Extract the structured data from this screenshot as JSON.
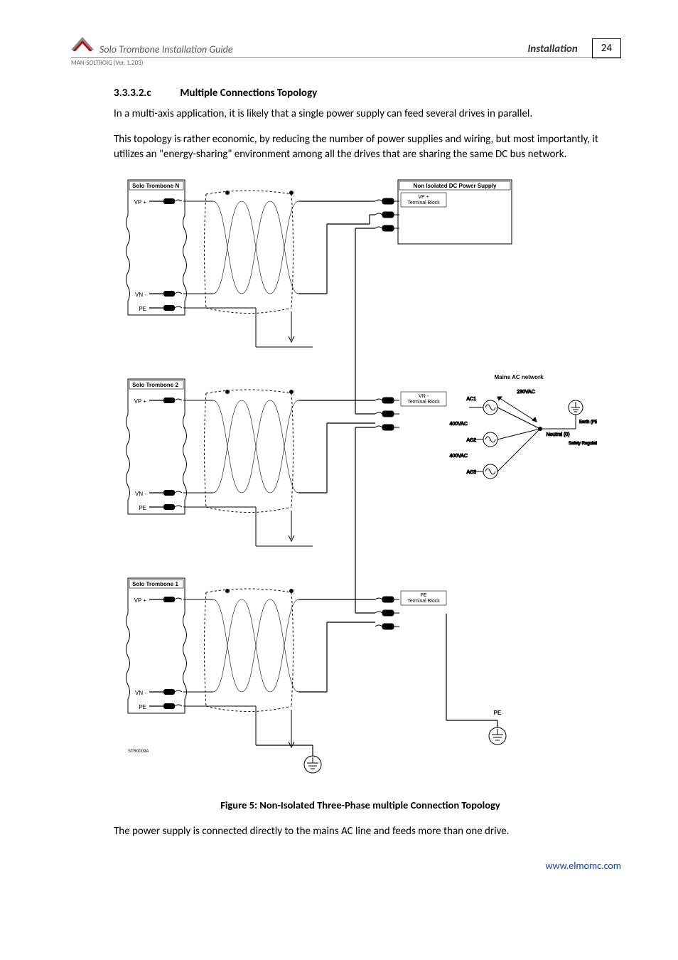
{
  "header": {
    "doc_title": "Solo Trombone Installation Guide",
    "section_label": "Installation",
    "page_number": "24",
    "version_line": "MAN-SOLTROIG (Ver. 1.203)"
  },
  "section": {
    "number": "3.3.3.2.c",
    "title": "Multiple Connections Topology",
    "para1": "In a multi-axis application, it is likely that a single power supply can feed several drives in parallel.",
    "para2": "This topology is rather economic, by reducing the number of power supplies and wiring, but most importantly, it utilizes an \"energy-sharing\" environment among all the drives that are sharing the same DC bus network.",
    "para3": "The power supply is connected directly to the mains AC line and feeds more than one drive."
  },
  "figure": {
    "caption": "Figure 5: Non-Isolated Three-Phase multiple Connection Topology",
    "drive_n": "Solo Trombone N",
    "drive_2": "Solo Trombone 2",
    "drive_1": "Solo Trombone 1",
    "psu": "Non Isolated DC Power Supply",
    "vp_plus": "VP +",
    "vn_minus": "VN -",
    "pe": "PE",
    "vp_block_l1": "VP +",
    "vp_block_l2": "Terminal Block",
    "vn_block_l1": "VN -",
    "vn_block_l2": "Terminal Block",
    "pe_block_l1": "PE",
    "pe_block_l2": "Terminal Block",
    "mains_title": "Mains AC network",
    "v230": "230VAC",
    "v400a": "400VAC",
    "v400b": "400VAC",
    "ac1": "AC1",
    "ac2": "AC2",
    "ac3": "AC3",
    "neutral": "Neutral (0)",
    "earth": "Earth (PE)",
    "safety": "Safety Regulations",
    "pe_right": "PE",
    "diagram_id": "STR0009A"
  },
  "footer": {
    "url": "www.elmomc.com"
  }
}
